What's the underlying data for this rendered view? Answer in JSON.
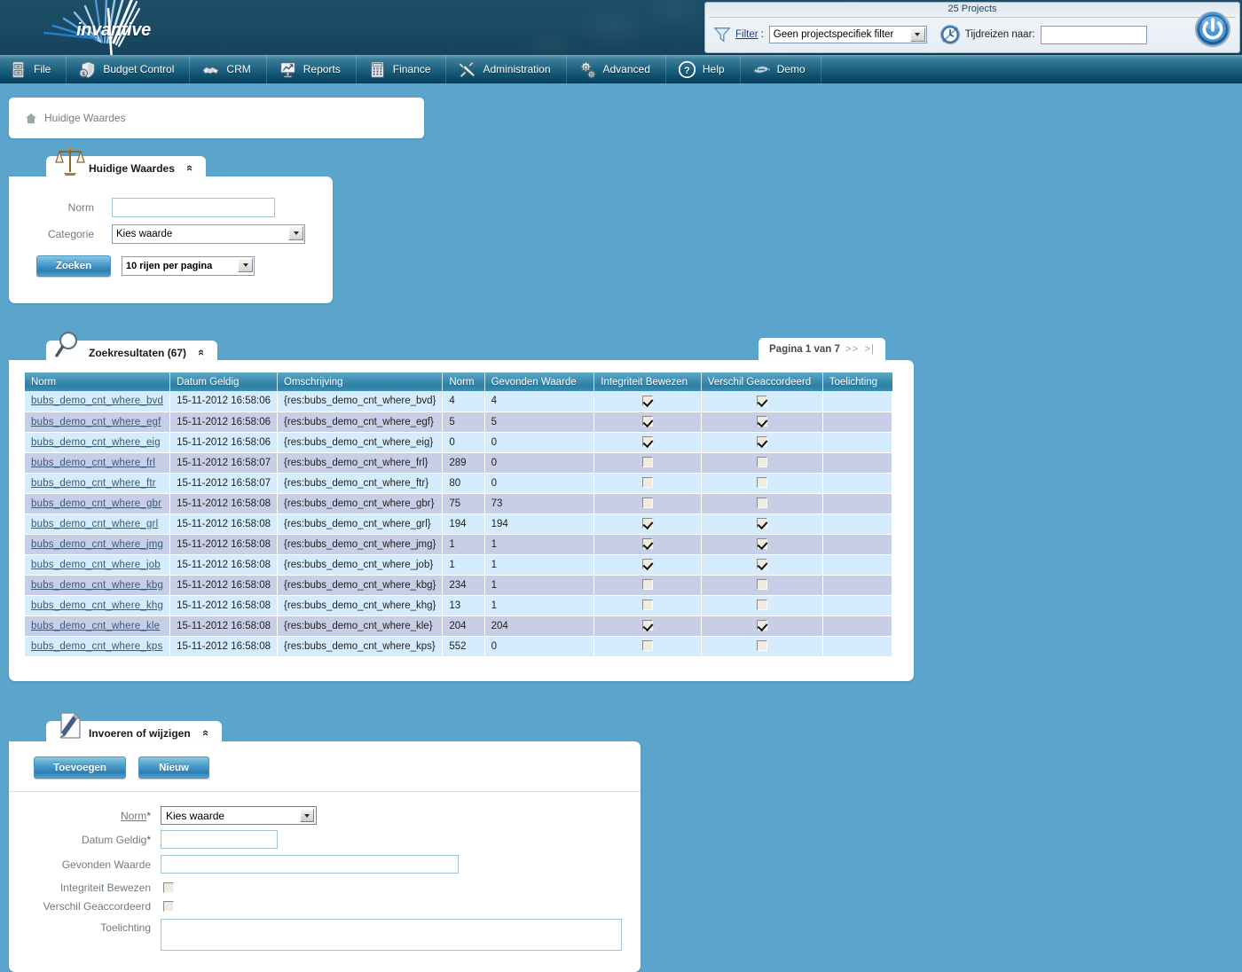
{
  "brand": {
    "name": "invantive"
  },
  "topbar": {
    "projects_count": "25 Projects",
    "filter_label": "Filter",
    "filter_colon": ":",
    "filter_value": "Geen projectspecifiek filter",
    "timetravel_label": "Tijdreizen naar:",
    "timetravel_value": "",
    "power_title": "Afmelden"
  },
  "menu": {
    "items": [
      {
        "label": "File",
        "icon": "cabinet-icon"
      },
      {
        "label": "Budget Control",
        "icon": "shield-coin-icon"
      },
      {
        "label": "CRM",
        "icon": "handshake-icon"
      },
      {
        "label": "Reports",
        "icon": "presentation-chart-icon"
      },
      {
        "label": "Finance",
        "icon": "calculator-icon"
      },
      {
        "label": "Administration",
        "icon": "tools-icon"
      },
      {
        "label": "Advanced",
        "icon": "gears-icon"
      },
      {
        "label": "Help",
        "icon": "question-circle-icon"
      },
      {
        "label": "Demo",
        "icon": "fish-icon"
      }
    ]
  },
  "breadcrumb": {
    "icon": "home-icon",
    "text": "Huidige Waardes"
  },
  "search_panel": {
    "tab_title": "Huidige Waardes",
    "tab_icon": "scales-icon",
    "collapse_glyph": "«",
    "norm_label": "Norm",
    "norm_value": "",
    "categorie_label": "Categorie",
    "categorie_value": "Kies waarde",
    "search_button": "Zoeken",
    "rows_per_page": "10 rijen per pagina"
  },
  "results_panel": {
    "tab_title": "Zoekresultaten (67)",
    "tab_icon": "magnifier-icon",
    "collapse_glyph": "«",
    "pager_text": "Pagina 1 van 7",
    "pager_next": ">>",
    "pager_last": ">|",
    "columns": [
      "Norm",
      "Datum Geldig",
      "Omschrijving",
      "Norm",
      "Gevonden Waarde",
      "Integriteit Bewezen",
      "Verschil Geaccordeerd",
      "Toelichting"
    ],
    "rows": [
      {
        "norm_link": "bubs_demo_cnt_where_bvd",
        "datum": "15-11-2012 16:58:06",
        "omschrijving": "{res:bubs_demo_cnt_where_bvd}",
        "norm": "4",
        "gevonden": "4",
        "integriteit": true,
        "verschil": true,
        "toelichting": ""
      },
      {
        "norm_link": "bubs_demo_cnt_where_egf",
        "datum": "15-11-2012 16:58:06",
        "omschrijving": "{res:bubs_demo_cnt_where_egf}",
        "norm": "5",
        "gevonden": "5",
        "integriteit": true,
        "verschil": true,
        "toelichting": ""
      },
      {
        "norm_link": "bubs_demo_cnt_where_eig",
        "datum": "15-11-2012 16:58:06",
        "omschrijving": "{res:bubs_demo_cnt_where_eig}",
        "norm": "0",
        "gevonden": "0",
        "integriteit": true,
        "verschil": true,
        "toelichting": ""
      },
      {
        "norm_link": "bubs_demo_cnt_where_frl",
        "datum": "15-11-2012 16:58:07",
        "omschrijving": "{res:bubs_demo_cnt_where_frl}",
        "norm": "289",
        "gevonden": "0",
        "integriteit": false,
        "verschil": false,
        "toelichting": ""
      },
      {
        "norm_link": "bubs_demo_cnt_where_ftr",
        "datum": "15-11-2012 16:58:07",
        "omschrijving": "{res:bubs_demo_cnt_where_ftr}",
        "norm": "80",
        "gevonden": "0",
        "integriteit": false,
        "verschil": false,
        "toelichting": ""
      },
      {
        "norm_link": "bubs_demo_cnt_where_gbr",
        "datum": "15-11-2012 16:58:08",
        "omschrijving": "{res:bubs_demo_cnt_where_gbr}",
        "norm": "75",
        "gevonden": "73",
        "integriteit": false,
        "verschil": false,
        "toelichting": ""
      },
      {
        "norm_link": "bubs_demo_cnt_where_grl",
        "datum": "15-11-2012 16:58:08",
        "omschrijving": "{res:bubs_demo_cnt_where_grl}",
        "norm": "194",
        "gevonden": "194",
        "integriteit": true,
        "verschil": true,
        "toelichting": ""
      },
      {
        "norm_link": "bubs_demo_cnt_where_jmg",
        "datum": "15-11-2012 16:58:08",
        "omschrijving": "{res:bubs_demo_cnt_where_jmg}",
        "norm": "1",
        "gevonden": "1",
        "integriteit": true,
        "verschil": true,
        "toelichting": ""
      },
      {
        "norm_link": "bubs_demo_cnt_where_job",
        "datum": "15-11-2012 16:58:08",
        "omschrijving": "{res:bubs_demo_cnt_where_job}",
        "norm": "1",
        "gevonden": "1",
        "integriteit": true,
        "verschil": true,
        "toelichting": ""
      },
      {
        "norm_link": "bubs_demo_cnt_where_kbg",
        "datum": "15-11-2012 16:58:08",
        "omschrijving": "{res:bubs_demo_cnt_where_kbg}",
        "norm": "234",
        "gevonden": "1",
        "integriteit": false,
        "verschil": false,
        "toelichting": ""
      },
      {
        "norm_link": "bubs_demo_cnt_where_khg",
        "datum": "15-11-2012 16:58:08",
        "omschrijving": "{res:bubs_demo_cnt_where_khg}",
        "norm": "13",
        "gevonden": "1",
        "integriteit": false,
        "verschil": false,
        "toelichting": ""
      },
      {
        "norm_link": "bubs_demo_cnt_where_kle",
        "datum": "15-11-2012 16:58:08",
        "omschrijving": "{res:bubs_demo_cnt_where_kle}",
        "norm": "204",
        "gevonden": "204",
        "integriteit": true,
        "verschil": true,
        "toelichting": ""
      },
      {
        "norm_link": "bubs_demo_cnt_where_kps",
        "datum": "15-11-2012 16:58:08",
        "omschrijving": "{res:bubs_demo_cnt_where_kps}",
        "norm": "552",
        "gevonden": "0",
        "integriteit": false,
        "verschil": false,
        "toelichting": ""
      }
    ]
  },
  "edit_panel": {
    "tab_title": "Invoeren of wijzigen",
    "tab_icon": "document-pen-icon",
    "collapse_glyph": "«",
    "add_button": "Toevoegen",
    "new_button": "Nieuw",
    "fields": {
      "norm_label": "Norm",
      "norm_required": "*",
      "norm_value": "Kies waarde",
      "datum_label": "Datum Geldig",
      "datum_required": "*",
      "datum_value": "",
      "gevonden_label": "Gevonden Waarde",
      "gevonden_value": "",
      "integriteit_label": "Integriteit Bewezen",
      "integriteit_checked": false,
      "verschil_label": "Verschil Geaccordeerd",
      "verschil_checked": false,
      "toelichting_label": "Toelichting",
      "toelichting_value": ""
    }
  },
  "colors": {
    "page_bg": "#5ba5cd",
    "banner": "#1a4a63",
    "menubar": "#1d6281",
    "grid_header": "#3f90b4",
    "row_odd": "#d4ecfb",
    "row_even": "#c9cee7",
    "link": "#3a5a7a",
    "button": "#3e92c4"
  }
}
